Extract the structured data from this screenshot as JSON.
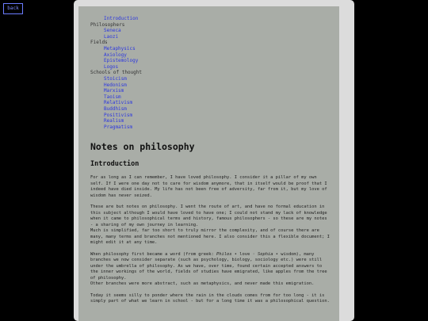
{
  "back_label": "back",
  "toc": {
    "intro": "Introduction",
    "philosophers_label": "Philosophers",
    "philosophers": [
      "Seneca",
      "Laozi"
    ],
    "fields_label": "Fields",
    "fields": [
      "Metaphysics",
      "Axiology",
      "Epistemology",
      "Logos"
    ],
    "schools_label": "Schools of thought",
    "schools": [
      "Stoicism",
      "Hedonism",
      "Marxism",
      "Taoism",
      "Relativism",
      "Buddhism",
      "Positivism",
      "Realism",
      "Pragmatism"
    ]
  },
  "main": {
    "title": "Notes on philosophy",
    "section_title": "Introduction",
    "p1": "For as long as I can remember, I have loved philosophy. I consider it a pillar of my own self. If I were one day not to care for wisdom anymore, that in itself would be proof that I indeed have died inside. My life has not been free of adversity, far from it, but my love of wisdom has never seized.",
    "p2a": "These are but notes on philosophy. I went the route of art, and have no formal education in this subject although I would have loved to have one; I could not stand my lack of knowledge when it came to philosophical terms and history, famous philosophers - so these are my notes - a sharing of my own journey in learning.",
    "p2b": "Much is simplified, far too short to truly mirror the complexity, and of course there are many, many terms and branches not mentioned here. I also consider this a flexible document; I might edit it at any time.",
    "p3_pre": "When philosophy first became a word (from greek: ",
    "p3_em1": "Philos",
    "p3_mid": " • love · ",
    "p3_em2": "Sophia",
    "p3_post": " • wisdom), many branches we now consider separate (such as psychology, biology, sociology etc.) were still under the umbrella of philosophy. As we have, over time, found certain accepted answers to the inner workings of the world, fields of studies have emigrated, like apples from the tree of philosophy.",
    "p3b": "Other branches were more abstract, such as metaphysics, and never made this emigration.",
    "p4": "Today it seems silly to ponder where the rain in the clouds comes from for too long - it is simply part of what we learn in school - but for a long time it was a philosophical question."
  }
}
